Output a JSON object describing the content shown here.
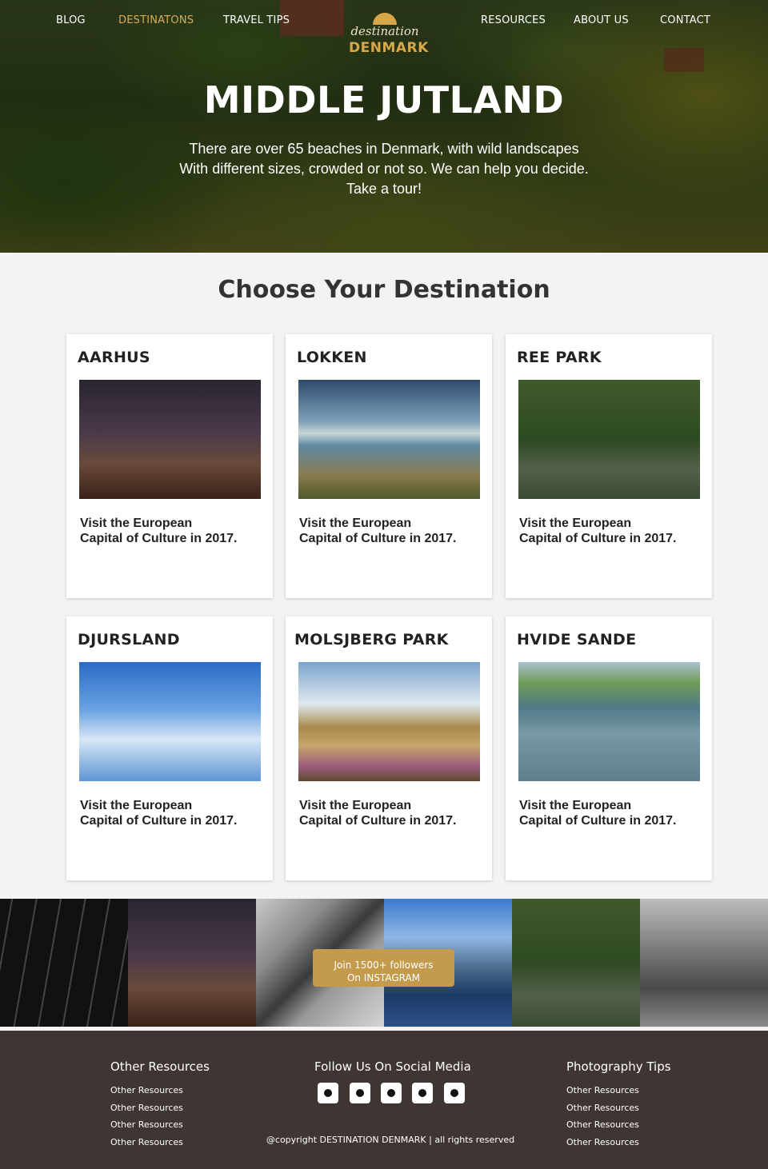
{
  "nav": {
    "left": [
      "BLOG",
      "DESTINATONS",
      "TRAVEL TIPS"
    ],
    "right": [
      "RESOURCES",
      "ABOUT US",
      "CONTACT"
    ],
    "active": "DESTINATONS"
  },
  "logo": {
    "script": "destination",
    "brand": "DENMARK"
  },
  "hero": {
    "title": "MIDDLE JUTLAND",
    "lines": [
      "There are over 65 beaches in Denmark, with wild landscapes",
      "With different sizes, crowded or not so. We can help you decide.",
      "Take a tour!"
    ]
  },
  "section": {
    "title": "Choose Your Destination"
  },
  "cards": [
    {
      "title": "AARHUS",
      "line1": "Visit the European",
      "line2": "Capital of Culture in 2017."
    },
    {
      "title": "LOKKEN",
      "line1": "Visit the European",
      "line2": "Capital of Culture in 2017."
    },
    {
      "title": "REE PARK",
      "line1": "Visit the European",
      "line2": "Capital of Culture in 2017."
    },
    {
      "title": "DJURSLAND",
      "line1": "Visit the European",
      "line2": "Capital of Culture in 2017."
    },
    {
      "title": "MOLSJBERG PARK",
      "line1": "Visit the European",
      "line2": "Capital of Culture in 2017."
    },
    {
      "title": "HVIDE SANDE",
      "line1": "Visit the European",
      "line2": "Capital of Culture in 2017."
    }
  ],
  "instagram": {
    "line1": "Join 1500+ followers",
    "line2": "On INSTAGRAM"
  },
  "footer": {
    "col1": {
      "title": "Other Resources",
      "items": [
        "Other Resources",
        "Other Resources",
        "Other Resources",
        "Other Resources"
      ]
    },
    "col2": {
      "title": "Follow Us On Social Media",
      "icons": [
        "social-icon-1",
        "social-icon-2",
        "social-icon-3",
        "social-icon-4",
        "social-icon-5"
      ]
    },
    "col3": {
      "title": "Photography Tips",
      "items": [
        "Other Resources",
        "Other Resources",
        "Other Resources",
        "Other Resources"
      ]
    },
    "copyright": "@copyright DESTINATION DENMARK | all rights reserved"
  },
  "colors": {
    "accent": "#d6ad5a",
    "button": "#c49a4c",
    "footer": "#3f3634",
    "page": "#f4f3f4"
  }
}
